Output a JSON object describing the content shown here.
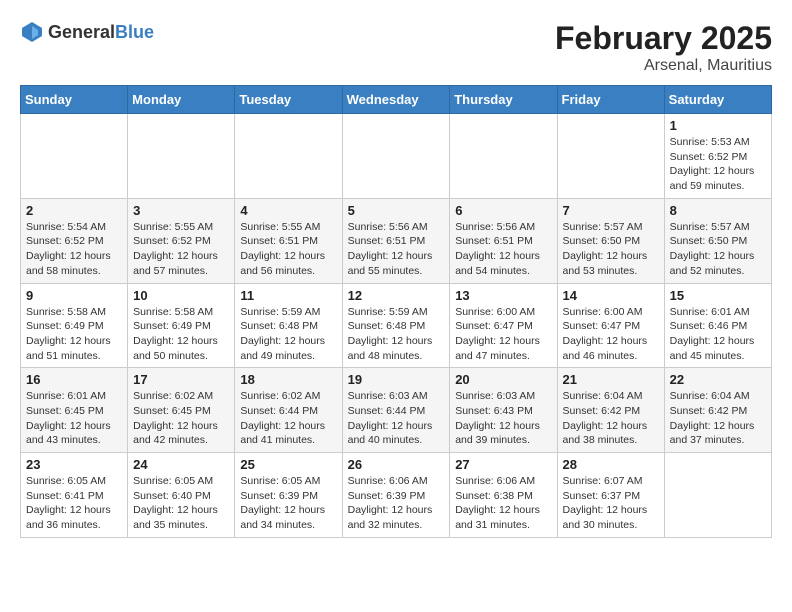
{
  "header": {
    "logo_general": "General",
    "logo_blue": "Blue",
    "month_year": "February 2025",
    "location": "Arsenal, Mauritius"
  },
  "days_of_week": [
    "Sunday",
    "Monday",
    "Tuesday",
    "Wednesday",
    "Thursday",
    "Friday",
    "Saturday"
  ],
  "weeks": [
    [
      {
        "day": "",
        "info": ""
      },
      {
        "day": "",
        "info": ""
      },
      {
        "day": "",
        "info": ""
      },
      {
        "day": "",
        "info": ""
      },
      {
        "day": "",
        "info": ""
      },
      {
        "day": "",
        "info": ""
      },
      {
        "day": "1",
        "info": "Sunrise: 5:53 AM\nSunset: 6:52 PM\nDaylight: 12 hours and 59 minutes."
      }
    ],
    [
      {
        "day": "2",
        "info": "Sunrise: 5:54 AM\nSunset: 6:52 PM\nDaylight: 12 hours and 58 minutes."
      },
      {
        "day": "3",
        "info": "Sunrise: 5:55 AM\nSunset: 6:52 PM\nDaylight: 12 hours and 57 minutes."
      },
      {
        "day": "4",
        "info": "Sunrise: 5:55 AM\nSunset: 6:51 PM\nDaylight: 12 hours and 56 minutes."
      },
      {
        "day": "5",
        "info": "Sunrise: 5:56 AM\nSunset: 6:51 PM\nDaylight: 12 hours and 55 minutes."
      },
      {
        "day": "6",
        "info": "Sunrise: 5:56 AM\nSunset: 6:51 PM\nDaylight: 12 hours and 54 minutes."
      },
      {
        "day": "7",
        "info": "Sunrise: 5:57 AM\nSunset: 6:50 PM\nDaylight: 12 hours and 53 minutes."
      },
      {
        "day": "8",
        "info": "Sunrise: 5:57 AM\nSunset: 6:50 PM\nDaylight: 12 hours and 52 minutes."
      }
    ],
    [
      {
        "day": "9",
        "info": "Sunrise: 5:58 AM\nSunset: 6:49 PM\nDaylight: 12 hours and 51 minutes."
      },
      {
        "day": "10",
        "info": "Sunrise: 5:58 AM\nSunset: 6:49 PM\nDaylight: 12 hours and 50 minutes."
      },
      {
        "day": "11",
        "info": "Sunrise: 5:59 AM\nSunset: 6:48 PM\nDaylight: 12 hours and 49 minutes."
      },
      {
        "day": "12",
        "info": "Sunrise: 5:59 AM\nSunset: 6:48 PM\nDaylight: 12 hours and 48 minutes."
      },
      {
        "day": "13",
        "info": "Sunrise: 6:00 AM\nSunset: 6:47 PM\nDaylight: 12 hours and 47 minutes."
      },
      {
        "day": "14",
        "info": "Sunrise: 6:00 AM\nSunset: 6:47 PM\nDaylight: 12 hours and 46 minutes."
      },
      {
        "day": "15",
        "info": "Sunrise: 6:01 AM\nSunset: 6:46 PM\nDaylight: 12 hours and 45 minutes."
      }
    ],
    [
      {
        "day": "16",
        "info": "Sunrise: 6:01 AM\nSunset: 6:45 PM\nDaylight: 12 hours and 43 minutes."
      },
      {
        "day": "17",
        "info": "Sunrise: 6:02 AM\nSunset: 6:45 PM\nDaylight: 12 hours and 42 minutes."
      },
      {
        "day": "18",
        "info": "Sunrise: 6:02 AM\nSunset: 6:44 PM\nDaylight: 12 hours and 41 minutes."
      },
      {
        "day": "19",
        "info": "Sunrise: 6:03 AM\nSunset: 6:44 PM\nDaylight: 12 hours and 40 minutes."
      },
      {
        "day": "20",
        "info": "Sunrise: 6:03 AM\nSunset: 6:43 PM\nDaylight: 12 hours and 39 minutes."
      },
      {
        "day": "21",
        "info": "Sunrise: 6:04 AM\nSunset: 6:42 PM\nDaylight: 12 hours and 38 minutes."
      },
      {
        "day": "22",
        "info": "Sunrise: 6:04 AM\nSunset: 6:42 PM\nDaylight: 12 hours and 37 minutes."
      }
    ],
    [
      {
        "day": "23",
        "info": "Sunrise: 6:05 AM\nSunset: 6:41 PM\nDaylight: 12 hours and 36 minutes."
      },
      {
        "day": "24",
        "info": "Sunrise: 6:05 AM\nSunset: 6:40 PM\nDaylight: 12 hours and 35 minutes."
      },
      {
        "day": "25",
        "info": "Sunrise: 6:05 AM\nSunset: 6:39 PM\nDaylight: 12 hours and 34 minutes."
      },
      {
        "day": "26",
        "info": "Sunrise: 6:06 AM\nSunset: 6:39 PM\nDaylight: 12 hours and 32 minutes."
      },
      {
        "day": "27",
        "info": "Sunrise: 6:06 AM\nSunset: 6:38 PM\nDaylight: 12 hours and 31 minutes."
      },
      {
        "day": "28",
        "info": "Sunrise: 6:07 AM\nSunset: 6:37 PM\nDaylight: 12 hours and 30 minutes."
      },
      {
        "day": "",
        "info": ""
      }
    ]
  ]
}
